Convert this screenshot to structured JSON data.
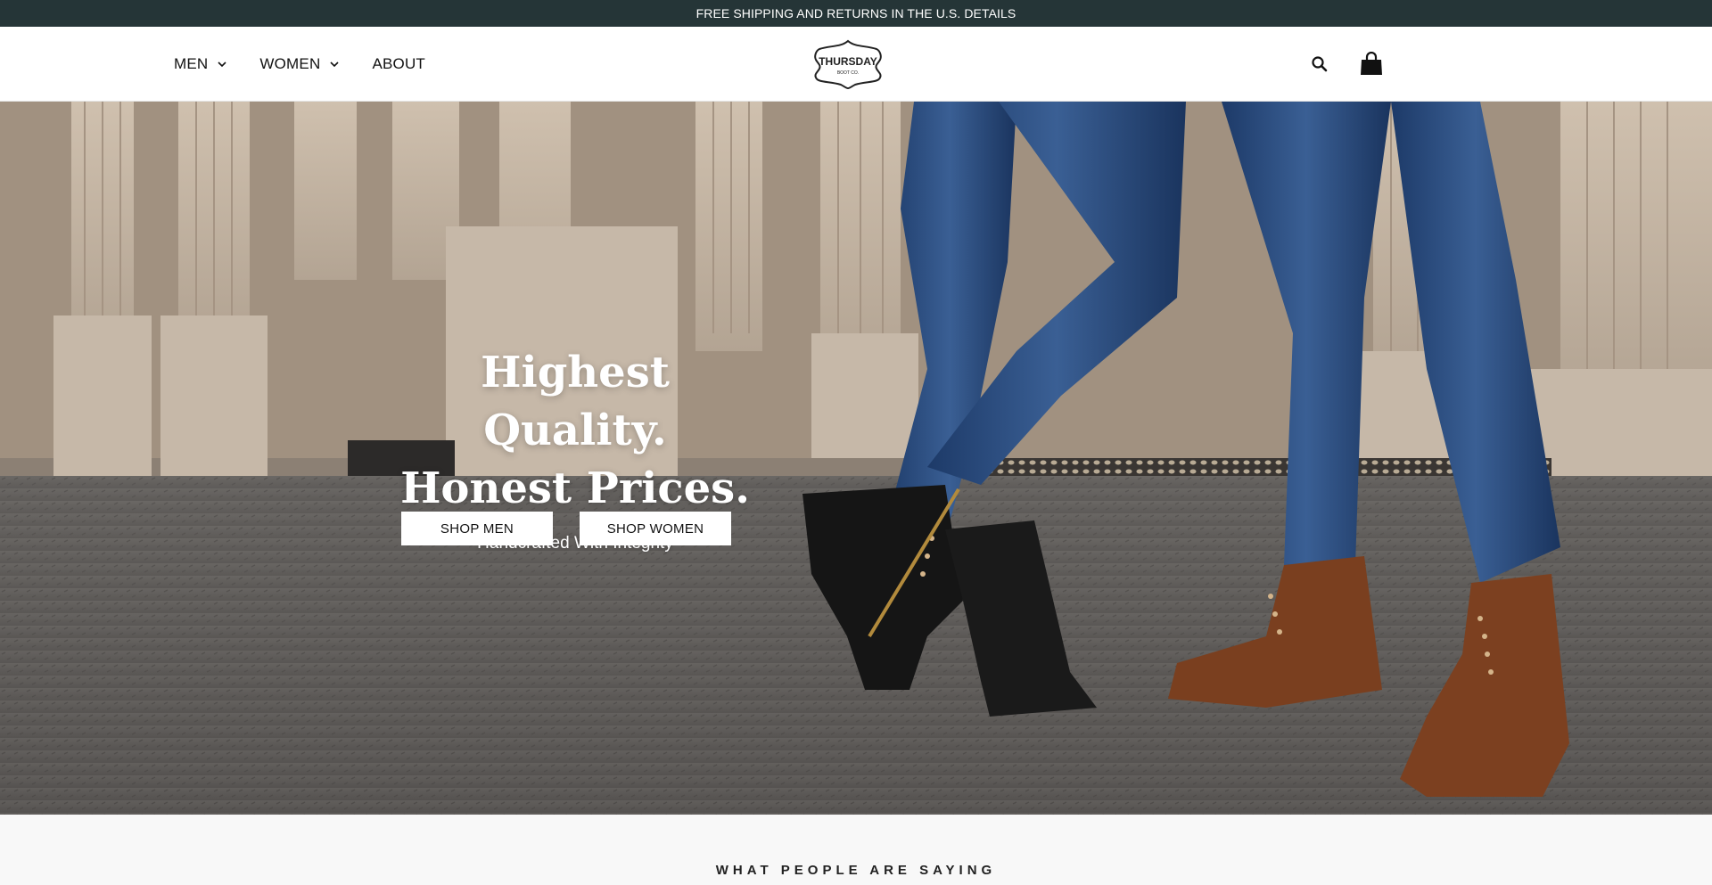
{
  "announcement": {
    "text": "FREE SHIPPING AND RETURNS IN THE U.S.",
    "link": "DETAILS"
  },
  "header": {
    "nav": [
      {
        "label": "MEN",
        "has_dropdown": true
      },
      {
        "label": "WOMEN",
        "has_dropdown": true
      },
      {
        "label": "ABOUT",
        "has_dropdown": false
      }
    ],
    "logo_text": "THURSDAY",
    "logo_subtext": "BOOT CO.",
    "icons": [
      "search-icon",
      "cart-icon"
    ]
  },
  "hero": {
    "title_line1": "Highest Quality.",
    "title_line2": "Honest Prices.",
    "subtitle": "Handcrafted With Integrity",
    "buttons": [
      "SHOP MEN",
      "SHOP WOMEN"
    ]
  },
  "reviews": {
    "title": "WHAT PEOPLE ARE SAYING"
  },
  "colors": {
    "announcement_bg": "#253537",
    "header_bg": "#ffffff",
    "button_bg": "#ffffff"
  }
}
